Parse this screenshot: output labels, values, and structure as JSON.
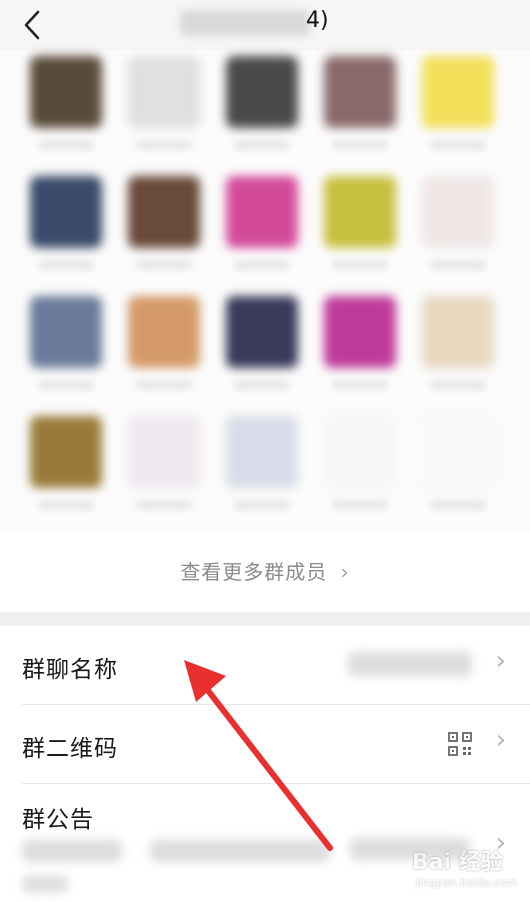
{
  "header": {
    "title_suffix": "4)"
  },
  "members_more_label": "查看更多群成员",
  "settings": {
    "group_name_label": "群聊名称",
    "qr_code_label": "群二维码",
    "announcement_label": "群公告"
  },
  "watermark": {
    "brand": "Bai 经验",
    "url": "jingyan.baidu.com"
  },
  "annotation": {
    "arrow_color": "#e8302e"
  },
  "avatar_colors": [
    "#5a4a3a",
    "#e0e0e0",
    "#4a4a4a",
    "#8a6a6a",
    "#f2e05a",
    "#3a4a6a",
    "#6a4a3a",
    "#d44a9a",
    "#c8c040",
    "#f0e6e6",
    "#6a7a9a",
    "#d49a6a",
    "#3a3a5a",
    "#c03a9a",
    "#e8d8c0",
    "#9a7a3a",
    "#f0e8f0",
    "#d8dce8",
    "#f6f6f6",
    "#f8f8f8"
  ]
}
